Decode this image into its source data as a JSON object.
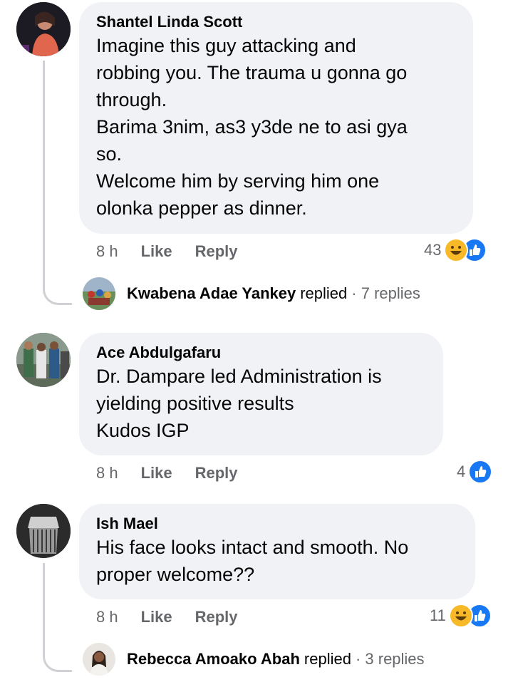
{
  "comments": [
    {
      "author": "Shantel Linda Scott",
      "lines": [
        "Imagine this guy attacking and",
        "robbing you. The trauma u gonna go",
        "through.",
        "Barima 3nim, as3 y3de ne to asi gya",
        "so.",
        "Welcome him by serving him one",
        "olonka pepper as dinner."
      ],
      "time": "8 h",
      "like_label": "Like",
      "reply_label": "Reply",
      "reaction_count": "43",
      "reactions": [
        "haha-icon",
        "like-icon"
      ],
      "reply_summary": {
        "name": "Kwabena Adae Yankey",
        "verb": "replied",
        "count": "· 7 replies"
      }
    },
    {
      "author": "Ace Abdulgafaru",
      "lines": [
        "Dr. Dampare led Administration is",
        "yielding positive results",
        "Kudos IGP"
      ],
      "time": "8 h",
      "like_label": "Like",
      "reply_label": "Reply",
      "reaction_count": "4",
      "reactions": [
        "like-icon"
      ]
    },
    {
      "author": "Ish Mael",
      "lines": [
        "His face looks intact and smooth. No",
        "proper welcome??"
      ],
      "time": "8 h",
      "like_label": "Like",
      "reply_label": "Reply",
      "reaction_count": "11",
      "reactions": [
        "haha-icon",
        "like-icon"
      ],
      "reply_summary": {
        "name": "Rebecca Amoako Abah",
        "verb": "replied",
        "count": "· 3 replies"
      }
    }
  ],
  "colors": {
    "bubble": "#f0f2f5",
    "meta_text": "#65676b",
    "like_blue": "#1877f2",
    "haha_yellow": "#f7b928"
  }
}
